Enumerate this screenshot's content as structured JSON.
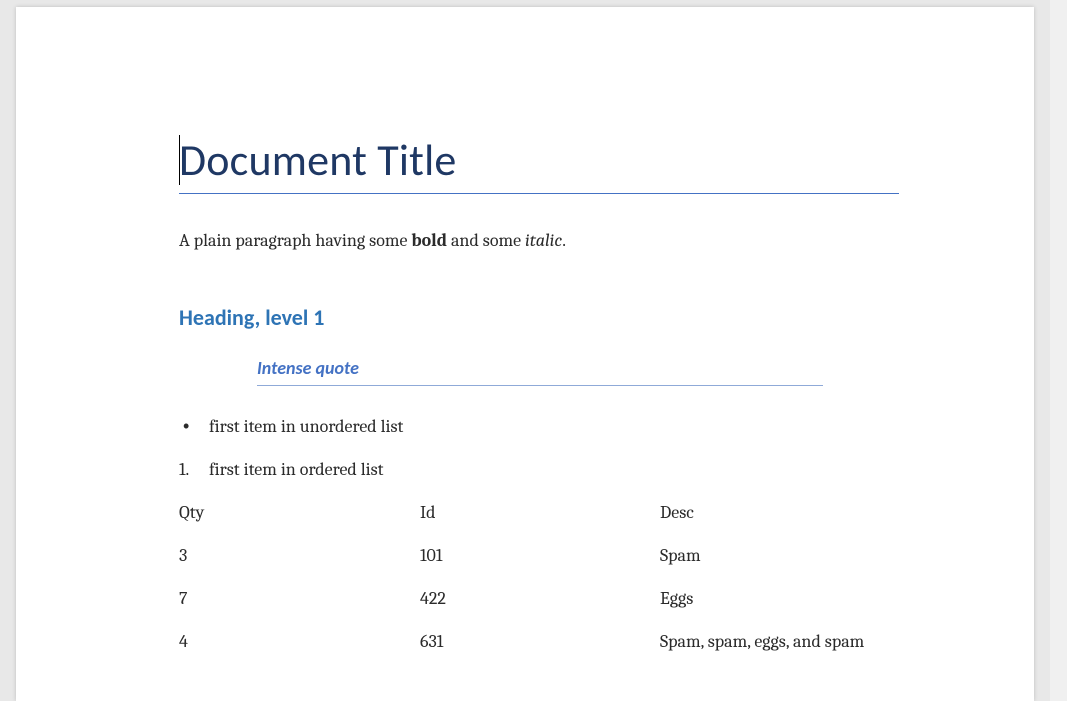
{
  "title": "Document Title",
  "paragraph": {
    "pre": "A plain paragraph having some ",
    "bold": "bold",
    "mid": " and some ",
    "italic": "italic",
    "post": "."
  },
  "heading1": "Heading, level 1",
  "quote": "Intense quote",
  "ul": {
    "item1": "first item in unordered list"
  },
  "ol": {
    "marker1": "1.",
    "item1": "first item in ordered list"
  },
  "table": {
    "headers": {
      "c1": "Qty",
      "c2": "Id",
      "c3": "Desc"
    },
    "rows": [
      {
        "c1": "3",
        "c2": "101",
        "c3": "Spam"
      },
      {
        "c1": "7",
        "c2": "422",
        "c3": "Eggs"
      },
      {
        "c1": "4",
        "c2": "631",
        "c3": "Spam, spam, eggs, and spam"
      }
    ]
  }
}
